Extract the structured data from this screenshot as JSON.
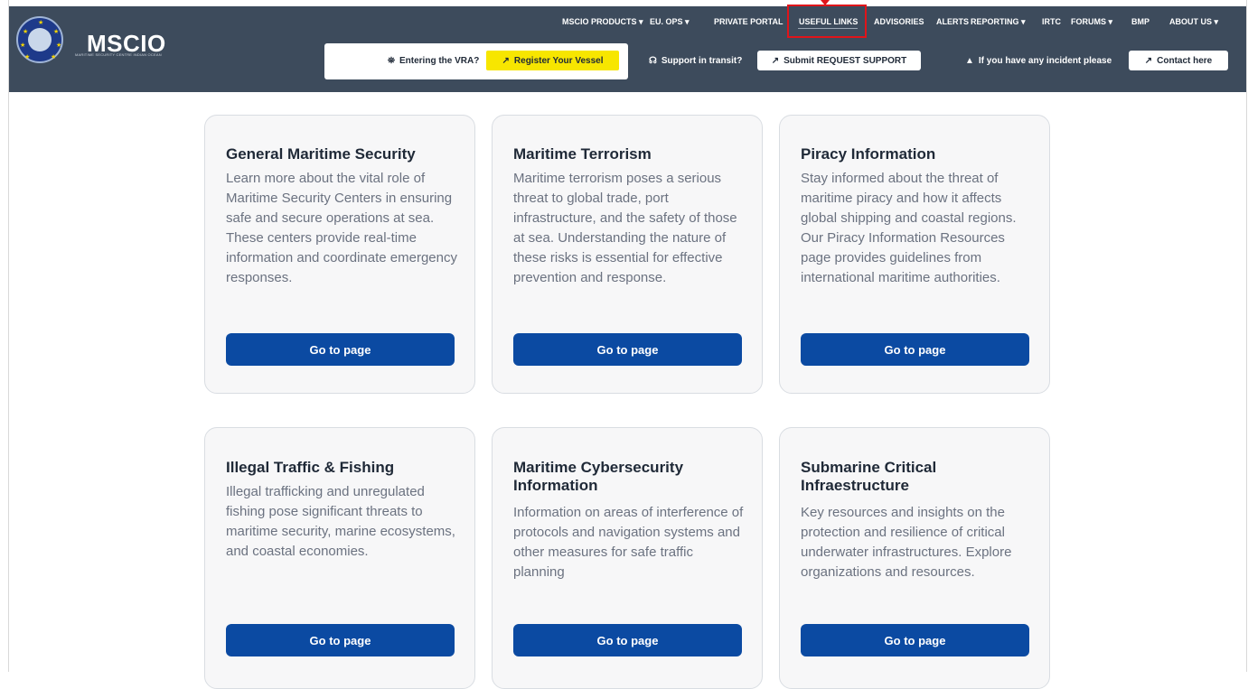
{
  "header": {
    "brand": "MSCIO",
    "brand_subtitle": "MARITIME SECURITY CENTRE INDIAN OCEAN",
    "nav": [
      {
        "label": "MSCIO PRODUCTS ▾"
      },
      {
        "label": "EU. OPS ▾"
      },
      {
        "label": "PRIVATE PORTAL"
      },
      {
        "label": "USEFUL LINKS"
      },
      {
        "label": "ADVISORIES"
      },
      {
        "label": "ALERTS"
      },
      {
        "label": "REPORTING ▾"
      },
      {
        "label": "IRTC"
      },
      {
        "label": "FORUMS ▾"
      },
      {
        "label": "BMP"
      },
      {
        "label": "ABOUT US ▾"
      }
    ],
    "vra_prompt": "Entering the VRA?",
    "vra_button": "Register Your Vessel",
    "support_prompt": "Support in transit?",
    "support_button": "Submit REQUEST SUPPORT",
    "incident_prompt": "If you have any incident please",
    "contact_button": "Contact here"
  },
  "cards": [
    {
      "title": "General Maritime Security",
      "description": "Learn more about the vital role of Maritime Security Centers in ensuring safe and secure operations at sea. These centers provide real-time information and coordinate emergency responses.",
      "button": "Go to page"
    },
    {
      "title": "Maritime Terrorism",
      "description": "Maritime terrorism poses a serious threat to global trade, port infrastructure, and the safety of those at sea. Understanding the nature of these risks is essential for effective prevention and response.",
      "button": "Go to page"
    },
    {
      "title": "Piracy Information",
      "description": "Stay informed about the threat of maritime piracy and how it affects global shipping and coastal regions. Our Piracy Information Resources page provides guidelines from international maritime authorities.",
      "button": "Go to page"
    },
    {
      "title": "Illegal Traffic & Fishing",
      "description": "Illegal trafficking and unregulated fishing pose significant threats to maritime security, marine ecosystems, and coastal economies.",
      "button": "Go to page"
    },
    {
      "title": "Maritime Cybersecurity Information",
      "description": "Information on areas of interference of protocols and navigation systems and other measures for safe traffic planning",
      "button": "Go to page"
    },
    {
      "title": "Submarine Critical Infraestructure",
      "description": "Key resources and insights on the protection and resilience of critical underwater infrastructures. Explore organizations and resources.",
      "button": "Go to page"
    }
  ],
  "colors": {
    "header_bg": "#3d4b5c",
    "primary_button": "#0b4aa2",
    "vra_button": "#f7e600",
    "highlight": "#e0141a"
  }
}
